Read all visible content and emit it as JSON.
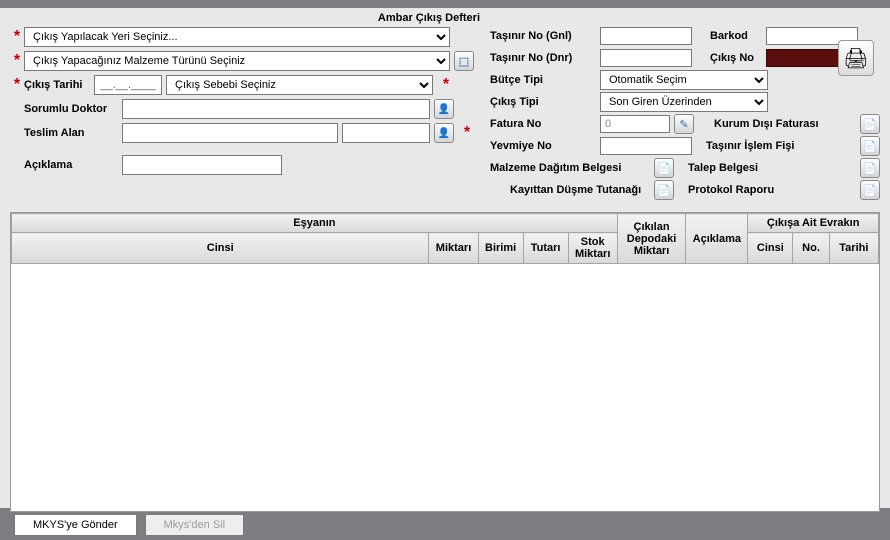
{
  "header": {
    "title": "Ambar Çıkış Defteri"
  },
  "left": {
    "sel_place": "Çıkış Yapılacak Yeri Seçiniz...",
    "sel_material": "Çıkış Yapacağınız Malzeme Türünü Seçiniz",
    "cikis_tarihi_label": "Çıkış Tarihi",
    "cikis_tarihi_value": "__.__.____",
    "cikis_sebebi": "Çıkış Sebebi Seçiniz",
    "sorumlu_doktor_label": "Sorumlu Doktor",
    "sorumlu_doktor_value": "",
    "teslim_alan_label": "Teslim Alan",
    "teslim_alan_value1": "",
    "teslim_alan_value2": "",
    "aciklama_label": "Açıklama",
    "aciklama_value": ""
  },
  "right": {
    "tasinir_gnl_label": "Taşınır No (Gnl)",
    "tasinir_gnl_value": "",
    "barkod_label": "Barkod",
    "barkod_value": "",
    "tasinir_dnr_label": "Taşınır No (Dnr)",
    "tasinir_dnr_value": "",
    "cikis_no_label": "Çıkış No",
    "butce_tipi_label": "Bütçe Tipi",
    "butce_tipi_value": "Otomatik Seçim",
    "cikis_tipi_label": "Çıkış Tipi",
    "cikis_tipi_value": "Son Giren Üzerinden",
    "fatura_no_label": "Fatura No",
    "fatura_no_value": "0",
    "kurum_disi_label": "Kurum Dışı Faturası",
    "yevmiye_no_label": "Yevmiye No",
    "yevmiye_no_value": "",
    "tasinir_fisi_label": "Taşınır İşlem Fişi",
    "malzeme_dagitim_label": "Malzeme Dağıtım Belgesi",
    "talep_belgesi_label": "Talep Belgesi",
    "kayittan_dusme_label": "Kayıttan Düşme Tutanağı",
    "protokol_raporu_label": "Protokol Raporu"
  },
  "grid": {
    "esyanin": "Eşyanın",
    "cinsi": "Cinsi",
    "miktari": "Miktarı",
    "birimi": "Birimi",
    "tutari": "Tutarı",
    "stok_miktari": "Stok Miktarı",
    "cikilan_depodaki": "Çıkılan Depodaki Miktarı",
    "aciklama": "Açıklama",
    "cikisa_ait": "Çıkışa Ait Evrakın",
    "ev_cinsi": "Cinsi",
    "ev_no": "No.",
    "ev_tarihi": "Tarihi"
  },
  "buttons": {
    "mkys_gonder": "MKYS'ye Gönder",
    "mkys_sil": "Mkys'den Sil"
  }
}
